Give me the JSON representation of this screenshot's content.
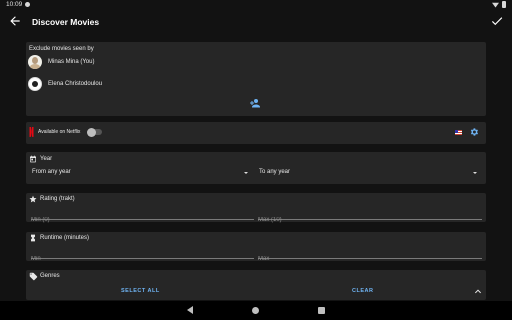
{
  "status_bar": {
    "time": "10:09"
  },
  "app_bar": {
    "title": "Discover Movies"
  },
  "exclude_seen": {
    "header": "Exclude movies seen by",
    "users": [
      {
        "name": "Minas Mina (You)"
      },
      {
        "name": "Elena Christodoulou"
      }
    ]
  },
  "streaming": {
    "label": "Available on Netflix",
    "enabled": false
  },
  "year": {
    "title": "Year",
    "from": "From any year",
    "to": "To any year"
  },
  "rating": {
    "title": "Rating (trakt)",
    "min_placeholder": "Min (0)",
    "max_placeholder": "Max (10)"
  },
  "runtime": {
    "title": "Runtime (minutes)",
    "min_placeholder": "Min",
    "max_placeholder": "Max"
  },
  "genres": {
    "title": "Genres",
    "select_all": "SELECT ALL",
    "clear": "CLEAR"
  },
  "colors": {
    "accent": "#6fb3f2",
    "netflix": "#e50914",
    "background": "#121212",
    "card": "#262626"
  }
}
